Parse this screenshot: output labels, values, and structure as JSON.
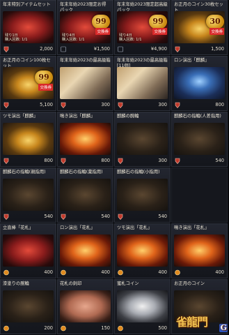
{
  "items": [
    {
      "name": "年末特別アイテムセット",
      "price": "2,000",
      "currency": "gem",
      "art": "red",
      "badge": "",
      "tag": "",
      "limit": "残り1日\n購入回数: 1/1"
    },
    {
      "name": "年末年始2023限定お得\nパック",
      "price": "¥1,500",
      "currency": "yen",
      "art": "red",
      "badge": "99",
      "badge_sub": "交換券",
      "tag": "",
      "limit": "残り4日\n購入回数: 1/1"
    },
    {
      "name": "年末年始2023限定超高級\nパック",
      "price": "¥4,900",
      "currency": "yen",
      "art": "red",
      "badge": "99",
      "badge_sub": "交換券",
      "tag": "",
      "limit": "残り4日\n購入回数: 1/1"
    },
    {
      "name": "お正月のコイン30枚セッ\nト",
      "price": "1,500",
      "currency": "gem",
      "art": "gold",
      "badge": "30",
      "badge_sub": "",
      "tag": "交換券",
      "limit": ""
    },
    {
      "name": "お正月のコイン100枚セット",
      "price": "5,100",
      "currency": "gem",
      "art": "gold",
      "badge": "99",
      "badge_sub": "",
      "tag": "交換券",
      "limit": ""
    },
    {
      "name": "年末年始2023の最高級箱",
      "price": "300",
      "currency": "gem",
      "art": "portrait",
      "badge": "",
      "tag": "",
      "limit": ""
    },
    {
      "name": "年末年始2023の最高級箱\n[11個]",
      "price": "300",
      "currency": "gem",
      "art": "portrait",
      "badge": "",
      "tag": "",
      "limit": ""
    },
    {
      "name": "ロン演出「麒麟」",
      "price": "800",
      "currency": "gem",
      "art": "blue",
      "badge": "",
      "tag": "",
      "limit": ""
    },
    {
      "name": "ツモ演出「麒麟」",
      "price": "800",
      "currency": "gem",
      "art": "gold",
      "badge": "",
      "tag": "",
      "limit": ""
    },
    {
      "name": "鳴き演出「麒麟」",
      "price": "800",
      "currency": "gem",
      "art": "fire",
      "badge": "",
      "tag": "",
      "limit": ""
    },
    {
      "name": "麒麟の腕輪",
      "price": "300",
      "currency": "gem",
      "art": "dark",
      "badge": "",
      "tag": "",
      "limit": ""
    },
    {
      "name": "麒麟石の指輪(人差指用)",
      "price": "540",
      "currency": "gem",
      "art": "dark",
      "badge": "",
      "tag": "",
      "limit": ""
    },
    {
      "name": "麒麟石の指輪(親指用)",
      "price": "540",
      "currency": "gem",
      "art": "dark",
      "badge": "",
      "tag": "",
      "limit": ""
    },
    {
      "name": "麒麟石の指輪(薬指用)",
      "price": "540",
      "currency": "gem",
      "art": "dark",
      "badge": "",
      "tag": "",
      "limit": ""
    },
    {
      "name": "麒麟石の指輪(小指用)",
      "price": "540",
      "currency": "gem",
      "art": "dark",
      "badge": "",
      "tag": "",
      "limit": ""
    },
    {
      "name": "",
      "price": "",
      "currency": "",
      "art": "",
      "badge": "",
      "tag": "",
      "limit": ""
    },
    {
      "name": "立直棒「花札」",
      "price": "400",
      "currency": "coin",
      "art": "red",
      "badge": "",
      "tag": "",
      "limit": ""
    },
    {
      "name": "ロン演出「花札」",
      "price": "400",
      "currency": "coin",
      "art": "fire",
      "badge": "",
      "tag": "",
      "limit": ""
    },
    {
      "name": "ツモ演出「花札」",
      "price": "400",
      "currency": "coin",
      "art": "fire",
      "badge": "",
      "tag": "",
      "limit": ""
    },
    {
      "name": "鳴き演出「花札」",
      "price": "400",
      "currency": "coin",
      "art": "fire",
      "badge": "",
      "tag": "",
      "limit": ""
    },
    {
      "name": "漆塗りの腕輪",
      "price": "200",
      "currency": "coin",
      "art": "dark",
      "badge": "",
      "tag": "",
      "limit": ""
    },
    {
      "name": "花札の刺印",
      "price": "150",
      "currency": "coin",
      "art": "hand",
      "badge": "",
      "tag": "",
      "limit": ""
    },
    {
      "name": "蜜札コイン",
      "price": "500",
      "currency": "coin",
      "art": "silver",
      "badge": "",
      "tag": "",
      "limit": ""
    },
    {
      "name": "お正月のコイン",
      "price": "",
      "currency": "",
      "art": "dark",
      "badge": "",
      "tag": "",
      "limit": ""
    }
  ],
  "watermark": {
    "text": "雀龍門",
    "badge": "G"
  },
  "colors": {
    "gem": "#c0392b",
    "yen": "#3b82c4",
    "coin": "#e08a1f"
  }
}
